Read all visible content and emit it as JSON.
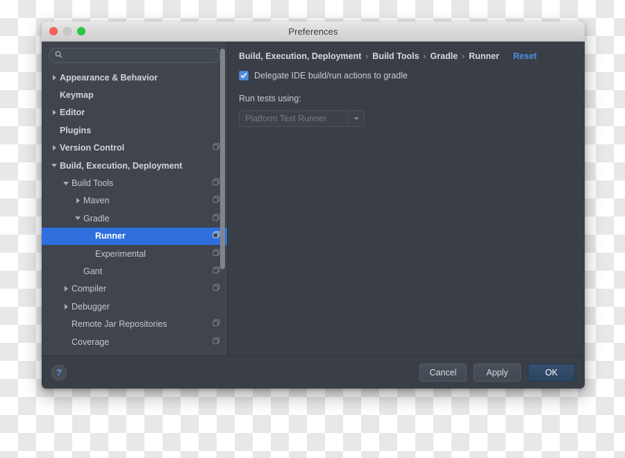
{
  "window": {
    "title": "Preferences",
    "traffic_lights": [
      "close-red",
      "minimize-gray",
      "zoom-green"
    ]
  },
  "sidebar": {
    "search": {
      "value": "",
      "placeholder": ""
    },
    "items": [
      {
        "label": "Appearance & Behavior",
        "indent": 0,
        "twisty": "closed",
        "bold": true,
        "copy": false,
        "selected": false
      },
      {
        "label": "Keymap",
        "indent": 0,
        "twisty": "none",
        "bold": true,
        "copy": false,
        "selected": false
      },
      {
        "label": "Editor",
        "indent": 0,
        "twisty": "closed",
        "bold": true,
        "copy": false,
        "selected": false
      },
      {
        "label": "Plugins",
        "indent": 0,
        "twisty": "none",
        "bold": true,
        "copy": false,
        "selected": false
      },
      {
        "label": "Version Control",
        "indent": 0,
        "twisty": "closed",
        "bold": true,
        "copy": true,
        "selected": false
      },
      {
        "label": "Build, Execution, Deployment",
        "indent": 0,
        "twisty": "open",
        "bold": true,
        "copy": false,
        "selected": false
      },
      {
        "label": "Build Tools",
        "indent": 1,
        "twisty": "open",
        "bold": false,
        "copy": true,
        "selected": false
      },
      {
        "label": "Maven",
        "indent": 2,
        "twisty": "closed",
        "bold": false,
        "copy": true,
        "selected": false
      },
      {
        "label": "Gradle",
        "indent": 2,
        "twisty": "open",
        "bold": false,
        "copy": true,
        "selected": false
      },
      {
        "label": "Runner",
        "indent": 3,
        "twisty": "none",
        "bold": false,
        "copy": true,
        "selected": true
      },
      {
        "label": "Experimental",
        "indent": 3,
        "twisty": "none",
        "bold": false,
        "copy": true,
        "selected": false
      },
      {
        "label": "Gant",
        "indent": 2,
        "twisty": "none",
        "bold": false,
        "copy": true,
        "selected": false
      },
      {
        "label": "Compiler",
        "indent": 1,
        "twisty": "closed",
        "bold": false,
        "copy": true,
        "selected": false
      },
      {
        "label": "Debugger",
        "indent": 1,
        "twisty": "closed",
        "bold": false,
        "copy": false,
        "selected": false
      },
      {
        "label": "Remote Jar Repositories",
        "indent": 1,
        "twisty": "none",
        "bold": false,
        "copy": true,
        "selected": false
      },
      {
        "label": "Coverage",
        "indent": 1,
        "twisty": "none",
        "bold": false,
        "copy": true,
        "selected": false
      }
    ]
  },
  "panel": {
    "breadcrumb": [
      "Build, Execution, Deployment",
      "Build Tools",
      "Gradle",
      "Runner"
    ],
    "breadcrumb_separator": "›",
    "reset_label": "Reset",
    "delegate_checkbox": {
      "label": "Delegate IDE build/run actions to gradle",
      "checked": true
    },
    "run_tests_label": "Run tests using:",
    "run_tests_select": {
      "value": "Platform Test Runner",
      "disabled": true
    }
  },
  "footer": {
    "help_label": "?",
    "cancel_label": "Cancel",
    "apply_label": "Apply",
    "ok_label": "OK"
  },
  "colors": {
    "selection_blue": "#2f6fdd",
    "accent_link": "#4a90e2",
    "sidebar_bg": "#3f444d",
    "panel_bg": "#3a3f47",
    "checkbox_blue": "#4e8ed8",
    "ok_button": "#2c4460"
  }
}
